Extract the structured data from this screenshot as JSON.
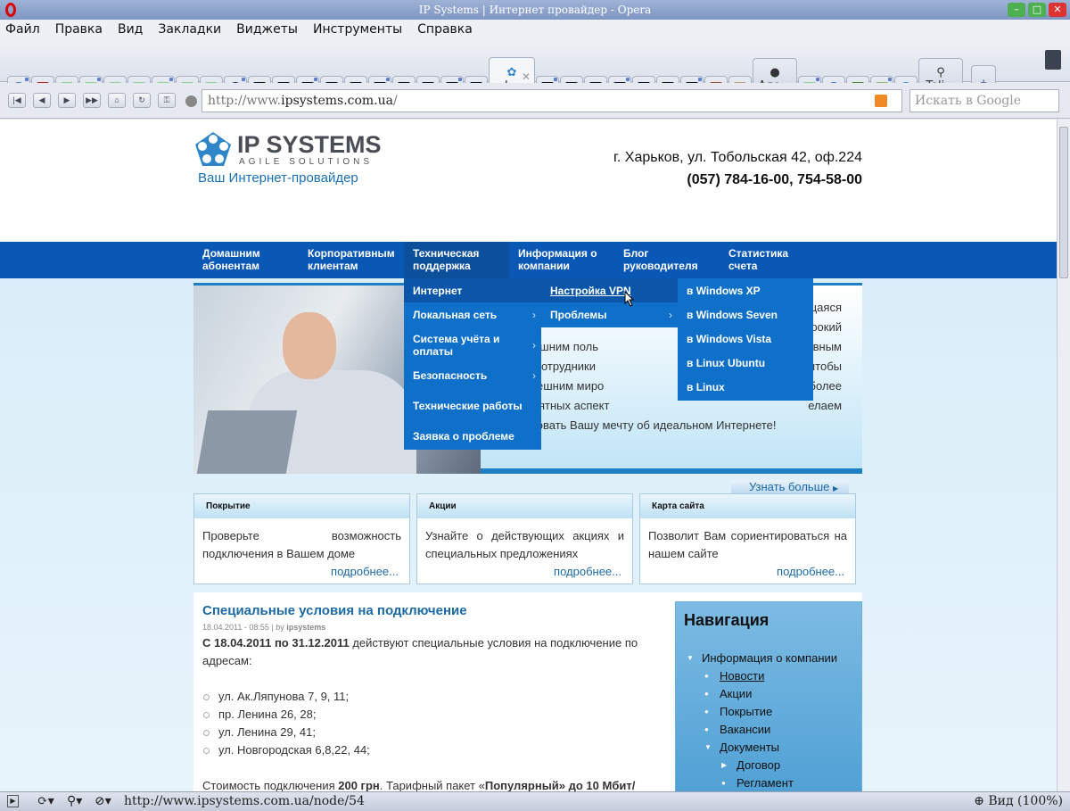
{
  "window": {
    "title": "IP Systems | Интернет провайдер - Opera"
  },
  "menu": [
    "Файл",
    "Правка",
    "Вид",
    "Закладки",
    "Виджеты",
    "Инструменты",
    "Справка"
  ],
  "tabs": {
    "left_icons": [
      "opera-e",
      "k",
      "doc",
      "doc",
      "doc",
      "doc",
      "doc",
      "doc",
      "doc",
      "bomb",
      "dark",
      "dark",
      "dark",
      "dark",
      "dark",
      "dark",
      "dark",
      "dark",
      "dark",
      "dark"
    ],
    "active_label": "I...",
    "right_icons_a": [
      "dark",
      "dark",
      "dark",
      "dark",
      "dark",
      "dark",
      "dark",
      "picture",
      "lamp"
    ],
    "tab_ale": "Але...",
    "right_icons_b": [
      "doc",
      "globe",
      "shield",
      "pencil",
      "drop"
    ],
    "tab_teli": "Teli...",
    "new_tab": "+",
    "colors": {
      "doc": "#8fcf8f",
      "dark": "#111111",
      "bomb": "#16306a",
      "opera-e": "#3a72c8",
      "k": "#c02020",
      "globe": "#2a70d0",
      "shield": "#3e8e2a",
      "pencil": "#8dbe6a",
      "drop": "#2a8fd8",
      "picture": "#a0522d",
      "lamp": "#c8a070"
    }
  },
  "address": {
    "prefix": "http://www.",
    "host": "ipsystems.com.ua",
    "suffix": "/",
    "search_placeholder": "Искать в Google"
  },
  "site": {
    "logo_name": "IP SYSTEMS",
    "logo_sub": "AGILE SOLUTIONS",
    "tagline": "Ваш Интернет-провайдер",
    "address": "г. Харьков, ул. Тобольская 42, оф.224",
    "phone": "(057) 784-16-00, 754-58-00",
    "nav": [
      {
        "l1": "Домашним",
        "l2": "абонентам"
      },
      {
        "l1": "Корпоративным",
        "l2": "клиентам"
      },
      {
        "l1": "Техническая",
        "l2": "поддержка"
      },
      {
        "l1": "Информация о",
        "l2": "компании"
      },
      {
        "l1": "Блог",
        "l2": "руководителя"
      },
      {
        "l1": "Статистика",
        "l2": "счета"
      }
    ],
    "dropdown1": [
      "Интернет",
      "Локальная сеть",
      "Система учёта и оплаты",
      "Безопасность",
      "Технические работы",
      "Заявка о проблеме"
    ],
    "dropdown2": [
      "Настройка VPN",
      "Проблемы"
    ],
    "dropdown3": [
      "в Windows XP",
      "в Windows Seven",
      "в Windows Vista",
      "в Linux Ubuntu",
      "в Linux"
    ],
    "hero_rows": [
      [
        "",
        "щаяся"
      ],
      [
        "",
        "широкий"
      ],
      [
        "услуг домашним поль",
        "ивным"
      ],
      [
        "ам. Наши сотрудники",
        "чтобы"
      ],
      [
        "кации с внешним миро",
        "иболее"
      ],
      [
        "тных и приятных аспект",
        "елаем"
      ],
      [
        "бы реализовать Вашу мечту об идеальном Интернете!",
        ""
      ]
    ],
    "more": "Узнать больше",
    "boxes": [
      {
        "title": "Покрытие",
        "text": "Проверьте возможность подключения в Вашем доме",
        "link": "подробнее..."
      },
      {
        "title": "Акции",
        "text": "Узнайте о действующих акциях и специальных предложениях",
        "link": "подробнее..."
      },
      {
        "title": "Карта сайта",
        "text": "Позволит Вам сориентироваться на нашем сайте",
        "link": "подробнее..."
      }
    ],
    "article": {
      "title": "Специальные условия на подключение",
      "date": "18.04.2011 - 08:55 | by ",
      "author": "ipsystems",
      "lead_bold": "С 18.04.2011 по 31.12.2011",
      "lead": " действуют специальные условия на подключение по адресам:",
      "addresses": [
        "ул. Ак.Ляпунова 7, 9, 11;",
        "пр. Ленина 26, 28;",
        "ул. Ленина 29, 41;",
        "ул. Новгородская 6,8,22, 44;"
      ],
      "cost_a": "Стоимость подключения ",
      "cost_b": "200 грн",
      "cost_c": ". Тарифный пакет «",
      "cost_d": "Популярный» до 10 Мбит/"
    },
    "sidenav": {
      "title": "Навигация",
      "items": [
        {
          "label": "Информация о компании",
          "level": 0,
          "mark": "▼"
        },
        {
          "label": "Новости",
          "level": 1,
          "mark": "●",
          "underline": true
        },
        {
          "label": "Акции",
          "level": 1,
          "mark": "●"
        },
        {
          "label": "Покрытие",
          "level": 1,
          "mark": "●"
        },
        {
          "label": "Вакансии",
          "level": 1,
          "mark": "●"
        },
        {
          "label": "Документы",
          "level": 1,
          "mark": "▼"
        },
        {
          "label": "Договор",
          "level": 2,
          "mark": "▶"
        },
        {
          "label": "Регламент",
          "level": 2,
          "mark": "●"
        }
      ]
    }
  },
  "status": {
    "url": "http://www.ipsystems.com.ua/node/54",
    "zoom": "Вид (100%)"
  }
}
